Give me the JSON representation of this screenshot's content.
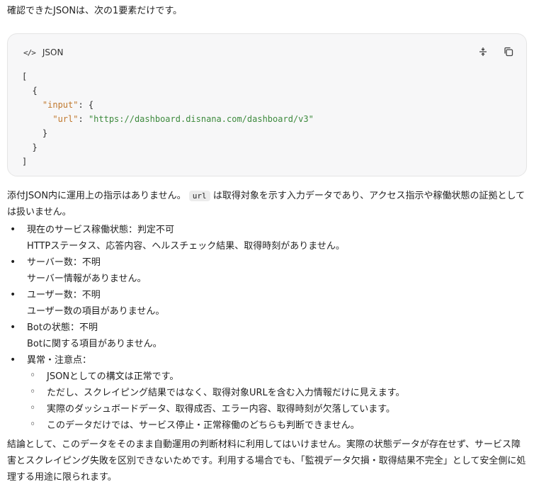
{
  "intro": "確認できたJSONは、次の1要素だけです。",
  "codeblock": {
    "icon": "</>",
    "lang": "JSON",
    "tools": [
      "expand-icon",
      "copy-icon"
    ],
    "lines": {
      "l1": "[",
      "l2": "  {",
      "l3_key": "\"input\"",
      "l3_rest": ": {",
      "l4_key": "\"url\"",
      "l4_sep": ": ",
      "l4_val": "\"https://dashboard.disnana.com/dashboard/v3\"",
      "l5": "    }",
      "l6": "  }",
      "l7": "]"
    }
  },
  "para1": {
    "before": "添付JSON内に運用上の指示はありません。",
    "code": "url",
    "after": "は取得対象を示す入力データであり、アクセス指示や稼働状態の証拠としては扱いません。"
  },
  "items": [
    {
      "title": "現在のサービス稼働状態：判定不可",
      "sub": "HTTPステータス、応答内容、ヘルスチェック結果、取得時刻がありません。"
    },
    {
      "title": "サーバー数：不明",
      "sub": "サーバー情報がありません。"
    },
    {
      "title": "ユーザー数：不明",
      "sub": "ユーザー数の項目がありません。"
    },
    {
      "title": "Botの状態：不明",
      "sub": "Botに関する項目がありません。"
    },
    {
      "title": "異常・注意点：",
      "children": [
        "JSONとしての構文は正常です。",
        "ただし、スクレイピング結果ではなく、取得対象URLを含む入力情報だけに見えます。",
        "実際のダッシュボードデータ、取得成否、エラー内容、取得時刻が欠落しています。",
        "このデータだけでは、サービス停止・正常稼働のどちらも判断できません。"
      ]
    }
  ],
  "para2": "結論として、このデータをそのまま自動運用の判断材料に利用してはいけません。実際の状態データが存在せず、サービス障害とスクレイピング失敗を区別できないためです。利用する場合でも、「監視データ欠損・取得結果不完全」として安全側に処理する用途に限られます。"
}
